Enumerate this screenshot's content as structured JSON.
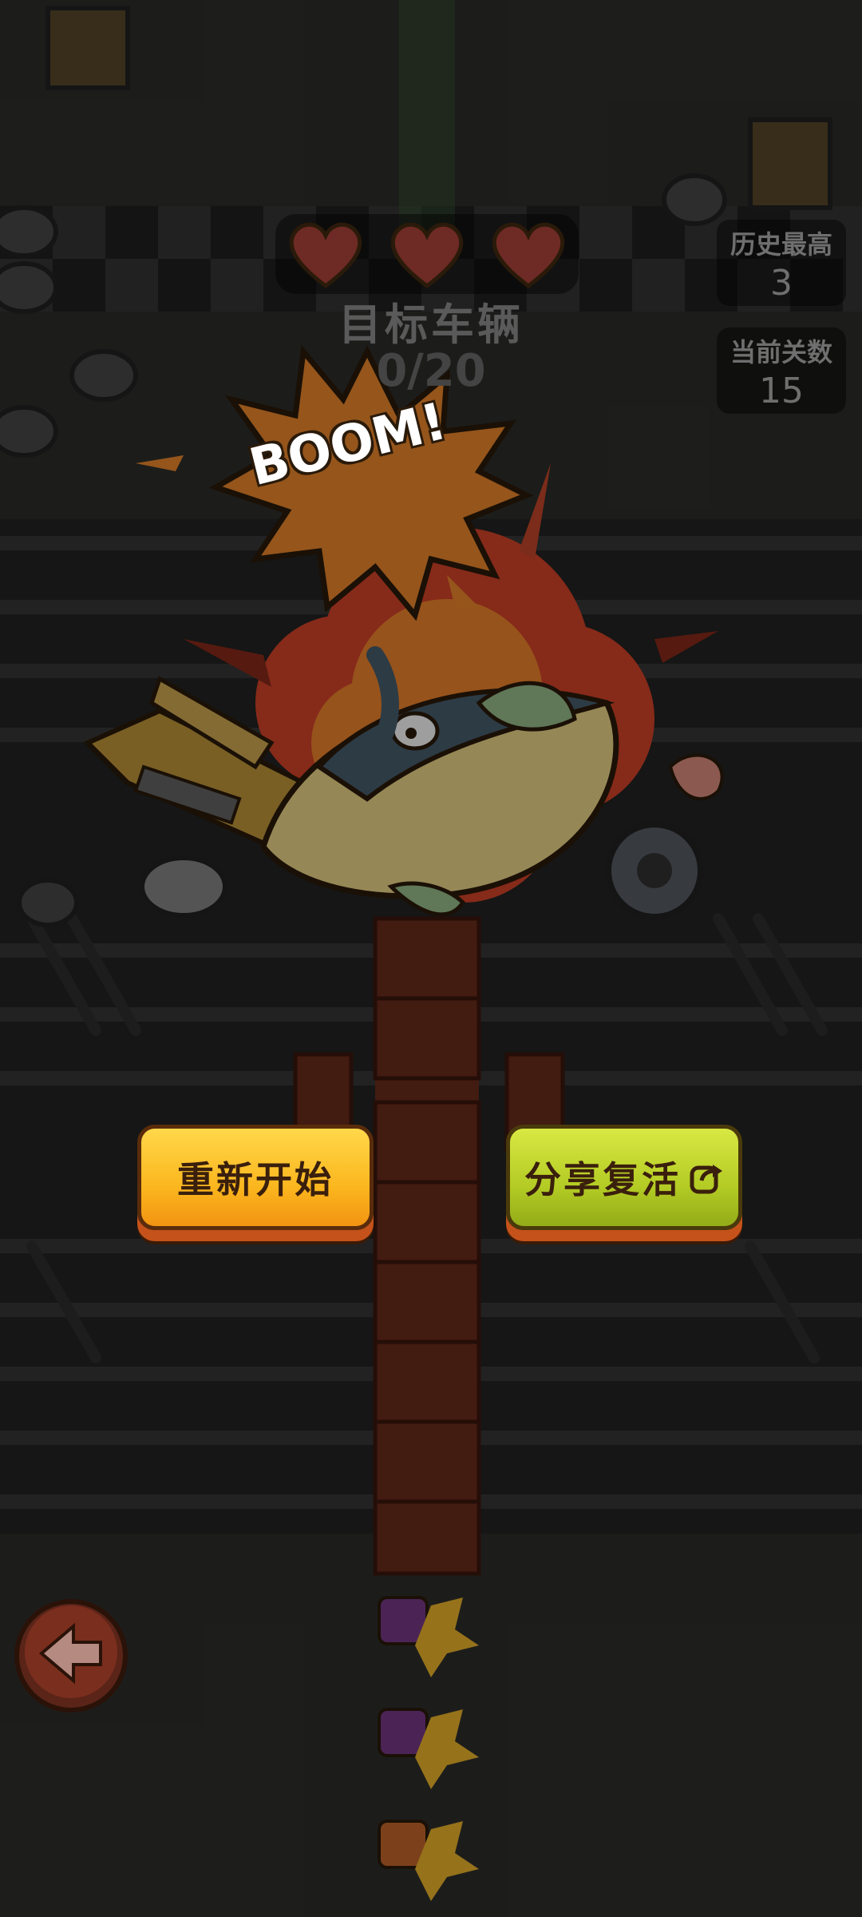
{
  "hud": {
    "lives": 3,
    "target_label": "目标车辆",
    "target_count": "0/20",
    "best_label": "历史最高",
    "best_value": "3",
    "level_label": "当前关数",
    "level_value": "15"
  },
  "effect": {
    "text": "BOOM!"
  },
  "buttons": {
    "restart": "重新开始",
    "share": "分享复活"
  },
  "icons": [
    "heart-icon",
    "share-icon",
    "back-arrow-icon"
  ],
  "colors": {
    "restart_button": "#fbb61e",
    "share_button": "#b3cb24",
    "boom_burst": "#f08a2c",
    "heart": "#c83a2e"
  }
}
